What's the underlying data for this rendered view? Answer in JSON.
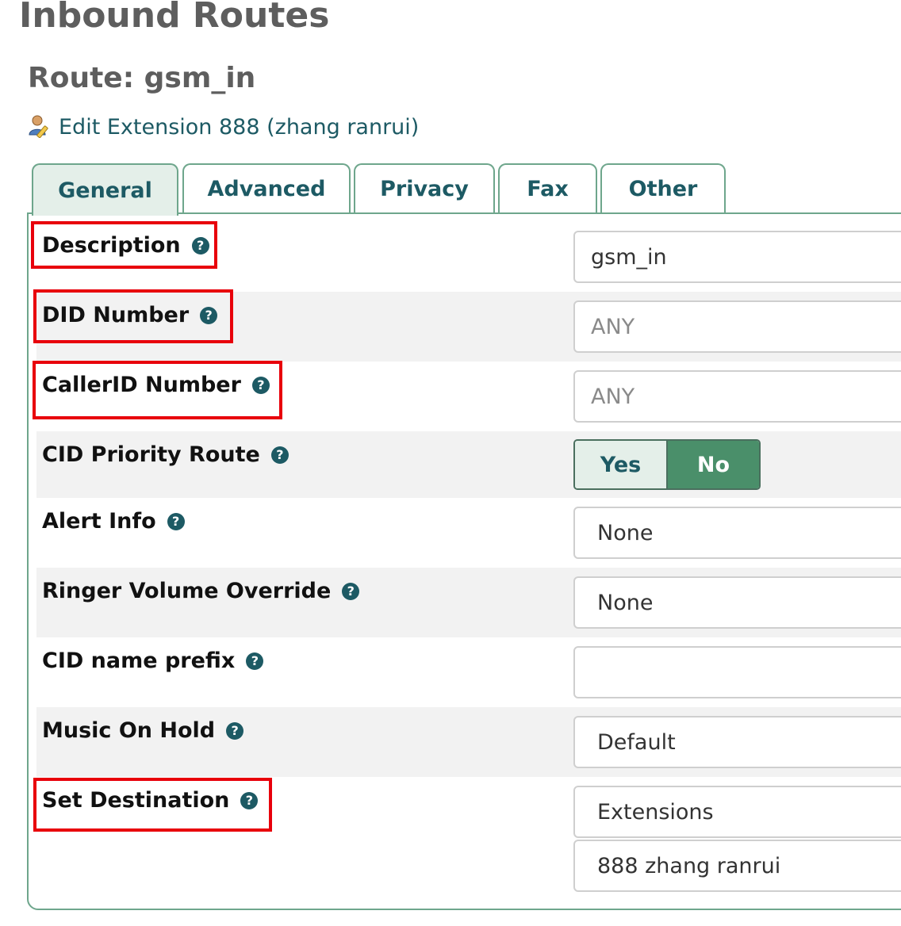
{
  "page": {
    "title": "Inbound Routes",
    "route_title": "Route: gsm_in"
  },
  "edit_link": {
    "icon": "user-edit-icon",
    "label": "Edit Extension 888 (zhang ranrui)"
  },
  "tabs": [
    {
      "label": "General",
      "active": true
    },
    {
      "label": "Advanced",
      "active": false
    },
    {
      "label": "Privacy",
      "active": false
    },
    {
      "label": "Fax",
      "active": false
    },
    {
      "label": "Other",
      "active": false
    }
  ],
  "help_glyph": "?",
  "form": {
    "description": {
      "label": "Description",
      "value": "gsm_in"
    },
    "did_number": {
      "label": "DID Number",
      "placeholder": "ANY"
    },
    "callerid_number": {
      "label": "CallerID Number",
      "placeholder": "ANY"
    },
    "cid_priority_route": {
      "label": "CID Priority Route",
      "yes": "Yes",
      "no": "No",
      "selected": "No"
    },
    "alert_info": {
      "label": "Alert Info",
      "value": "None"
    },
    "ringer_volume_override": {
      "label": "Ringer Volume Override",
      "value": "None"
    },
    "cid_name_prefix": {
      "label": "CID name prefix",
      "value": ""
    },
    "music_on_hold": {
      "label": "Music On Hold",
      "value": "Default"
    },
    "set_destination": {
      "label": "Set Destination",
      "type_value": "Extensions",
      "target_value": "888 zhang ranrui"
    }
  },
  "colors": {
    "accent": "#1d5a64",
    "tab_border": "#6ea68c",
    "toggle_selected": "#4a8f6a",
    "highlight_box": "#e8000b"
  }
}
